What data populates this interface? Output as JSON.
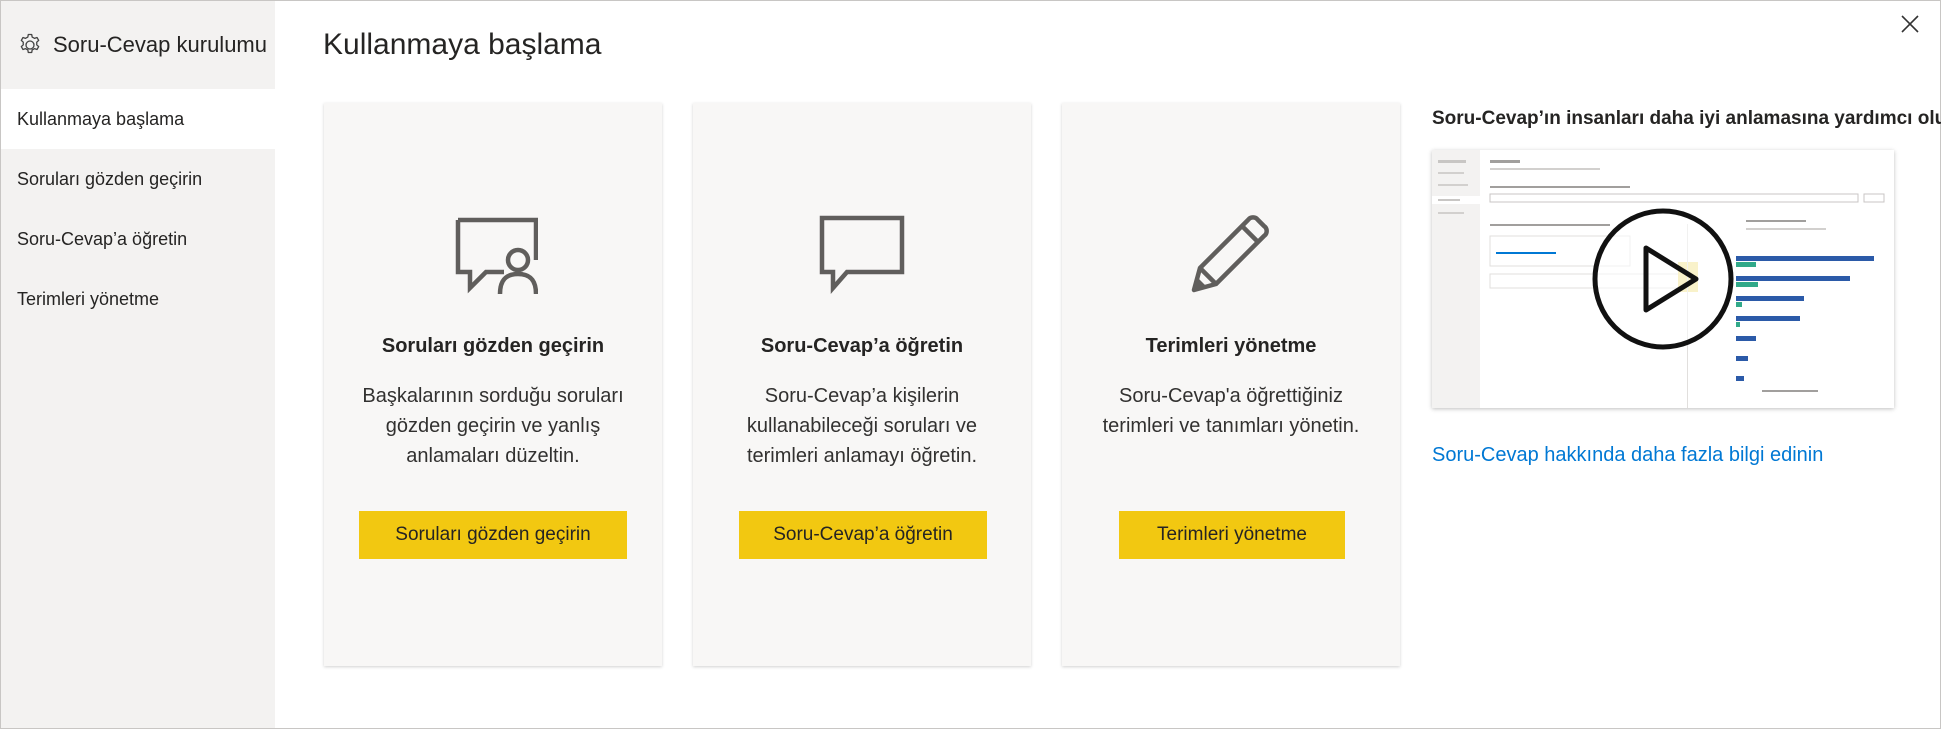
{
  "sidebar": {
    "title": "Soru-Cevap kurulumu",
    "icon": "gear-icon",
    "items": [
      {
        "label": "Kullanmaya başlama",
        "active": true
      },
      {
        "label": "Soruları gözden geçirin",
        "active": false
      },
      {
        "label": "Soru-Cevap’a öğretin",
        "active": false
      },
      {
        "label": "Terimleri yönetme",
        "active": false
      }
    ]
  },
  "main": {
    "title": "Kullanmaya başlama",
    "cards": [
      {
        "icon": "chat-person-icon",
        "title": "Soruları gözden geçirin",
        "description": "Başkalarının sorduğu soruları gözden geçirin ve yanlış anlamaları düzeltin.",
        "button": "Soruları gözden geçirin"
      },
      {
        "icon": "speech-bubble-icon",
        "title": "Soru-Cevap’a öğretin",
        "description": "Soru-Cevap’a kişilerin kullanabileceği soruları ve terimleri anlamayı öğretin.",
        "button": "Soru-Cevap’a öğretin"
      },
      {
        "icon": "pencil-icon",
        "title": "Terimleri yönetme",
        "description": "Soru-Cevap'a öğrettiğiniz terimleri ve tanımları yönetin.",
        "button": "Terimleri yönetme"
      }
    ],
    "video": {
      "heading": "Soru-Cevap’ın insanları daha iyi anlamasına yardımcı olun",
      "thumbnail_icon": "play-icon"
    },
    "learn_more_link": "Soru-Cevap hakkında daha fazla bilgi edinin"
  },
  "colors": {
    "button_yellow": "#f2c811",
    "link_blue": "#0078d4",
    "sidebar_bg": "#f3f2f1",
    "card_bg": "#f8f7f6"
  },
  "close_icon": "close-icon"
}
